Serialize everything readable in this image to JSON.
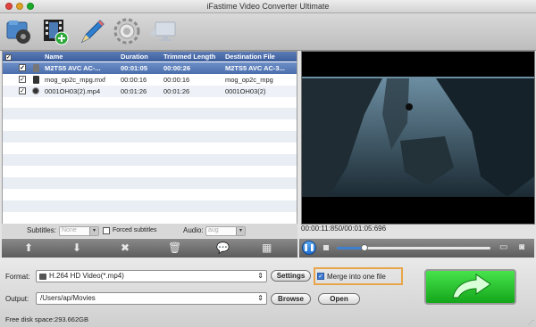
{
  "window": {
    "title": "iFastime Video Converter Ultimate"
  },
  "toolbar": {
    "buttons": [
      {
        "icon": "add-video-icon"
      },
      {
        "icon": "add-folder-icon"
      },
      {
        "icon": "edit-icon"
      },
      {
        "icon": "settings-icon"
      },
      {
        "icon": "display-icon"
      }
    ]
  },
  "file_list": {
    "columns": [
      "Name",
      "Duration",
      "Trimmed Length",
      "Destination File"
    ],
    "rows": [
      {
        "name": "M2TS5 AVC AC-...",
        "duration": "00:01:05",
        "trimmed": "00:00:26",
        "dest": "M2TS5 AVC AC-3...",
        "checked": true,
        "selected": true
      },
      {
        "name": "mog_op2c_mpg.mxf",
        "duration": "00:00:16",
        "trimmed": "00:00:16",
        "dest": "mog_op2c_mpg",
        "checked": true,
        "selected": false
      },
      {
        "name": "0001OH03(2).mp4",
        "duration": "00:01:26",
        "trimmed": "00:01:26",
        "dest": "0001OH03(2)",
        "checked": true,
        "selected": false
      }
    ]
  },
  "subtitles": {
    "label": "Subtitles:",
    "value": "None",
    "forced_label": "Forced subtitles",
    "audio_label": "Audio:",
    "audio_value": "aug"
  },
  "preview": {
    "time": "00:00:11:850/00:01:05:696",
    "progress": 0.18
  },
  "format": {
    "label": "Format:",
    "value": "H.264 HD Video(*.mp4)",
    "settings_label": "Settings",
    "merge_label": "Merge into one file",
    "merge_checked": true
  },
  "output": {
    "label": "Output:",
    "value": "/Users/ap/Movies",
    "browse_label": "Browse",
    "open_label": "Open"
  },
  "status": {
    "free_disk": "Free disk space:293.662GB"
  },
  "colors": {
    "accent": "#e8a54a",
    "selection": "#4a6ead",
    "convert": "#14a61b"
  }
}
